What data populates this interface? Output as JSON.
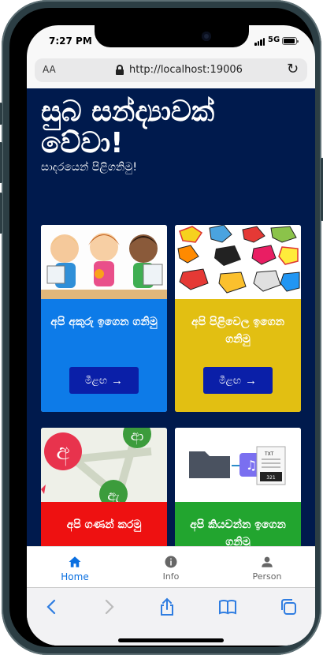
{
  "status_bar": {
    "time": "7:27 PM",
    "network": "5G"
  },
  "browser": {
    "text_size_label": "AA",
    "url": "http://localhost:19006"
  },
  "page": {
    "title": "සුබ සන්ද්‍යාවක් වේවා!",
    "subtitle": "සාදරයෙන් පිළිගනිමු!"
  },
  "cards": [
    {
      "title": "අපි අකුරු ඉගෙන ගනිමු",
      "button_label": "මීළඟ",
      "color": "#0d7be8"
    },
    {
      "title": "අපි පිළිවෙල ඉගෙන ගනිමු",
      "button_label": "මීළඟ",
      "color": "#e2bf12"
    },
    {
      "title": "අපි ගණන් කරමු",
      "color": "#ee1111"
    },
    {
      "title": "අපි කියවන්න ඉගෙන ගනිමු",
      "color": "#22a52f"
    }
  ],
  "card_images": {
    "audio_card_labels": [
      "TXT",
      "321"
    ]
  },
  "bottom_nav": [
    {
      "label": "Home",
      "icon": "home-icon",
      "active": true,
      "color": "#0a6fe0"
    },
    {
      "label": "Info",
      "icon": "info-icon",
      "active": false,
      "color": "#666666"
    },
    {
      "label": "Person",
      "icon": "person-icon",
      "active": false,
      "color": "#666666"
    }
  ],
  "safari_toolbar": [
    "back-icon",
    "forward-icon",
    "share-icon",
    "bookmarks-icon",
    "tabs-icon"
  ]
}
